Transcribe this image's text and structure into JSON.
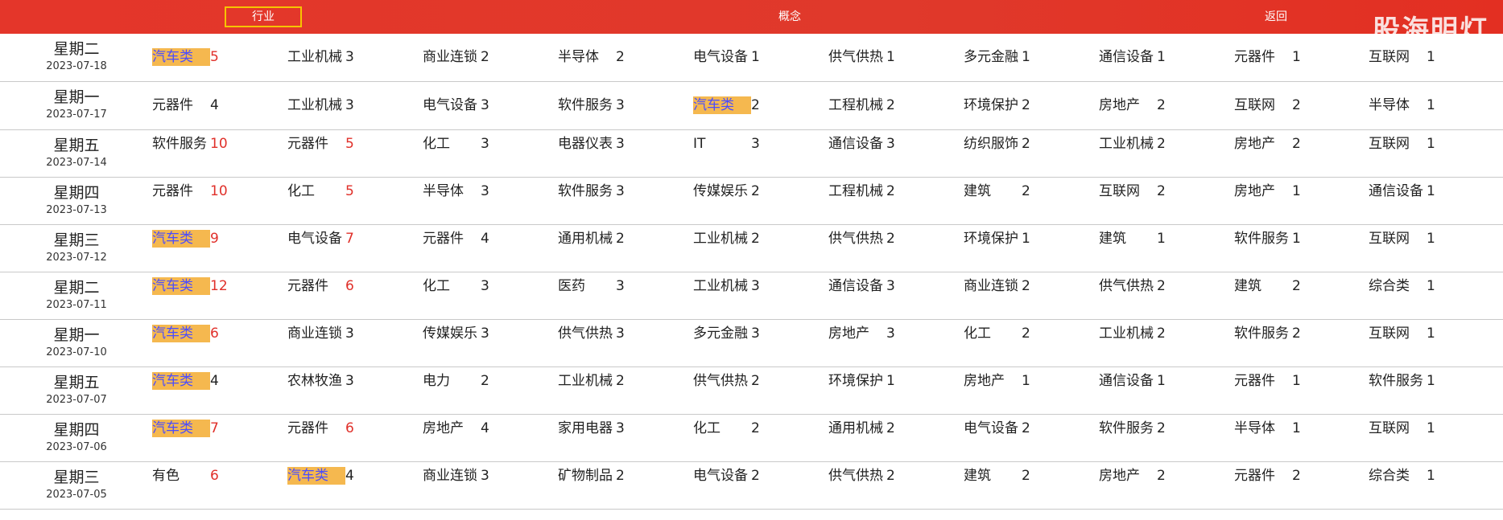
{
  "header": {
    "tabs": [
      {
        "label": "行业"
      },
      {
        "label": "概念"
      },
      {
        "label": "返回"
      }
    ],
    "watermark": "股海明灯"
  },
  "rows": [
    {
      "weekday": "星期二",
      "date": "2023-07-18",
      "items": [
        {
          "name": "汽车类",
          "count": "5",
          "hl": true,
          "red": true
        },
        {
          "name": "工业机械",
          "count": "3"
        },
        {
          "name": "商业连锁",
          "count": "2"
        },
        {
          "name": "半导体",
          "count": "2"
        },
        {
          "name": "电气设备",
          "count": "1"
        },
        {
          "name": "供气供热",
          "count": "1"
        },
        {
          "name": "多元金融",
          "count": "1"
        },
        {
          "name": "通信设备",
          "count": "1"
        },
        {
          "name": "元器件",
          "count": "1"
        },
        {
          "name": "互联网",
          "count": "1"
        }
      ]
    },
    {
      "weekday": "星期一",
      "date": "2023-07-17",
      "items": [
        {
          "name": "元器件",
          "count": "4"
        },
        {
          "name": "工业机械",
          "count": "3"
        },
        {
          "name": "电气设备",
          "count": "3"
        },
        {
          "name": "软件服务",
          "count": "3"
        },
        {
          "name": "汽车类",
          "count": "2",
          "hl": true
        },
        {
          "name": "工程机械",
          "count": "2"
        },
        {
          "name": "环境保护",
          "count": "2"
        },
        {
          "name": "房地产",
          "count": "2"
        },
        {
          "name": "互联网",
          "count": "2"
        },
        {
          "name": "半导体",
          "count": "1"
        }
      ]
    },
    {
      "weekday": "星期五",
      "date": "2023-07-14",
      "items": [
        {
          "name": "软件服务",
          "count": "10",
          "red": true
        },
        {
          "name": "元器件",
          "count": "5",
          "red": true
        },
        {
          "name": "化工",
          "count": "3"
        },
        {
          "name": "电器仪表",
          "count": "3"
        },
        {
          "name": "IT",
          "count": "3"
        },
        {
          "name": "通信设备",
          "count": "3"
        },
        {
          "name": "纺织服饰",
          "count": "2"
        },
        {
          "name": "工业机械",
          "count": "2"
        },
        {
          "name": "房地产",
          "count": "2"
        },
        {
          "name": "互联网",
          "count": "1"
        }
      ]
    },
    {
      "weekday": "星期四",
      "date": "2023-07-13",
      "items": [
        {
          "name": "元器件",
          "count": "10",
          "red": true
        },
        {
          "name": "化工",
          "count": "5",
          "red": true
        },
        {
          "name": "半导体",
          "count": "3"
        },
        {
          "name": "软件服务",
          "count": "3"
        },
        {
          "name": "传媒娱乐",
          "count": "2"
        },
        {
          "name": "工程机械",
          "count": "2"
        },
        {
          "name": "建筑",
          "count": "2"
        },
        {
          "name": "互联网",
          "count": "2"
        },
        {
          "name": "房地产",
          "count": "1"
        },
        {
          "name": "通信设备",
          "count": "1"
        }
      ]
    },
    {
      "weekday": "星期三",
      "date": "2023-07-12",
      "items": [
        {
          "name": "汽车类",
          "count": "9",
          "hl": true,
          "red": true
        },
        {
          "name": "电气设备",
          "count": "7",
          "red": true
        },
        {
          "name": "元器件",
          "count": "4"
        },
        {
          "name": "通用机械",
          "count": "2"
        },
        {
          "name": "工业机械",
          "count": "2"
        },
        {
          "name": "供气供热",
          "count": "2"
        },
        {
          "name": "环境保护",
          "count": "1"
        },
        {
          "name": "建筑",
          "count": "1"
        },
        {
          "name": "软件服务",
          "count": "1"
        },
        {
          "name": "互联网",
          "count": "1"
        }
      ]
    },
    {
      "weekday": "星期二",
      "date": "2023-07-11",
      "items": [
        {
          "name": "汽车类",
          "count": "12",
          "hl": true,
          "red": true
        },
        {
          "name": "元器件",
          "count": "6",
          "red": true
        },
        {
          "name": "化工",
          "count": "3"
        },
        {
          "name": "医药",
          "count": "3"
        },
        {
          "name": "工业机械",
          "count": "3"
        },
        {
          "name": "通信设备",
          "count": "3"
        },
        {
          "name": "商业连锁",
          "count": "2"
        },
        {
          "name": "供气供热",
          "count": "2"
        },
        {
          "name": "建筑",
          "count": "2"
        },
        {
          "name": "综合类",
          "count": "1"
        }
      ]
    },
    {
      "weekday": "星期一",
      "date": "2023-07-10",
      "items": [
        {
          "name": "汽车类",
          "count": "6",
          "hl": true,
          "red": true
        },
        {
          "name": "商业连锁",
          "count": "3"
        },
        {
          "name": "传媒娱乐",
          "count": "3"
        },
        {
          "name": "供气供热",
          "count": "3"
        },
        {
          "name": "多元金融",
          "count": "3"
        },
        {
          "name": "房地产",
          "count": "3"
        },
        {
          "name": "化工",
          "count": "2"
        },
        {
          "name": "工业机械",
          "count": "2"
        },
        {
          "name": "软件服务",
          "count": "2"
        },
        {
          "name": "互联网",
          "count": "1"
        }
      ]
    },
    {
      "weekday": "星期五",
      "date": "2023-07-07",
      "items": [
        {
          "name": "汽车类",
          "count": "4",
          "hl": true
        },
        {
          "name": "农林牧渔",
          "count": "3"
        },
        {
          "name": "电力",
          "count": "2"
        },
        {
          "name": "工业机械",
          "count": "2"
        },
        {
          "name": "供气供热",
          "count": "2"
        },
        {
          "name": "环境保护",
          "count": "1"
        },
        {
          "name": "房地产",
          "count": "1"
        },
        {
          "name": "通信设备",
          "count": "1"
        },
        {
          "name": "元器件",
          "count": "1"
        },
        {
          "name": "软件服务",
          "count": "1"
        }
      ]
    },
    {
      "weekday": "星期四",
      "date": "2023-07-06",
      "items": [
        {
          "name": "汽车类",
          "count": "7",
          "hl": true,
          "red": true
        },
        {
          "name": "元器件",
          "count": "6",
          "red": true
        },
        {
          "name": "房地产",
          "count": "4"
        },
        {
          "name": "家用电器",
          "count": "3"
        },
        {
          "name": "化工",
          "count": "2"
        },
        {
          "name": "通用机械",
          "count": "2"
        },
        {
          "name": "电气设备",
          "count": "2"
        },
        {
          "name": "软件服务",
          "count": "2"
        },
        {
          "name": "半导体",
          "count": "1"
        },
        {
          "name": "互联网",
          "count": "1"
        }
      ]
    },
    {
      "weekday": "星期三",
      "date": "2023-07-05",
      "items": [
        {
          "name": "有色",
          "count": "6",
          "red": true
        },
        {
          "name": "汽车类",
          "count": "4",
          "hl": true
        },
        {
          "name": "商业连锁",
          "count": "3"
        },
        {
          "name": "矿物制品",
          "count": "2"
        },
        {
          "name": "电气设备",
          "count": "2"
        },
        {
          "name": "供气供热",
          "count": "2"
        },
        {
          "name": "建筑",
          "count": "2"
        },
        {
          "name": "房地产",
          "count": "2"
        },
        {
          "name": "元器件",
          "count": "2"
        },
        {
          "name": "综合类",
          "count": "1"
        }
      ]
    }
  ]
}
